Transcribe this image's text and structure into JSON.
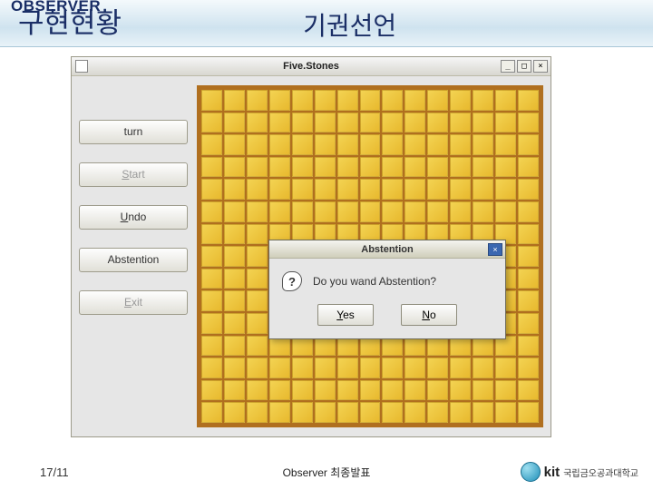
{
  "header": {
    "tag": "OBSERVER",
    "title_left": "구현현황",
    "title_right": "기권선언"
  },
  "window": {
    "title": "Five.Stones",
    "buttons": {
      "turn": "turn",
      "start": "Start",
      "undo": "Undo",
      "abstention": "Abstention",
      "exit": "Exit"
    }
  },
  "dialog": {
    "title": "Abstention",
    "message": "Do you wand Abstention?",
    "yes": "Yes",
    "no": "No"
  },
  "footer": {
    "page": "17/11",
    "center": "Observer 최종발표",
    "logo_text": "kit",
    "logo_sub": "국립금오공과대학교"
  }
}
